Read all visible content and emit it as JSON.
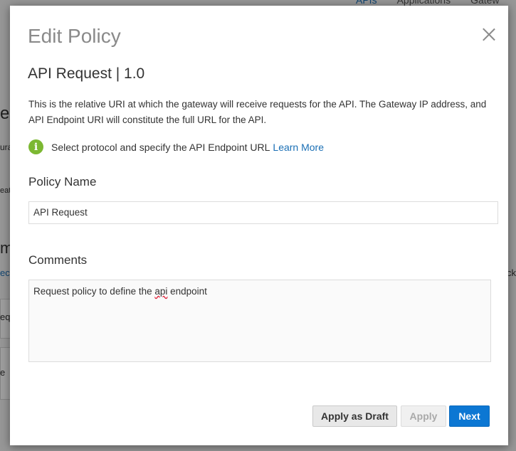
{
  "background": {
    "nav": [
      "APIs",
      "Applications",
      "Gatew"
    ],
    "fragments": [
      "e",
      "ura",
      "eate",
      "m",
      "ec",
      "eq",
      "e",
      "ck"
    ]
  },
  "dialog": {
    "title": "Edit Policy",
    "subtitle": "API Request | 1.0",
    "description": "This is the relative URI at which the gateway will receive requests for the API. The Gateway IP address, and API Endpoint URI will constitute the full URL for the API.",
    "info_icon": "info-icon",
    "info_text": "Select protocol and specify the API Endpoint URL",
    "learn_more": "Learn More",
    "policy_name_label": "Policy Name",
    "policy_name_value": "API Request",
    "comments_label": "Comments",
    "comments_before": "Request policy to define the ",
    "comments_misspelled": "api",
    "comments_after": " endpoint",
    "buttons": {
      "apply_as_draft": "Apply as Draft",
      "apply": "Apply",
      "next": "Next"
    },
    "colors": {
      "accent": "#0c77d3",
      "info": "#7cb832",
      "link": "#1a6fb5"
    }
  }
}
